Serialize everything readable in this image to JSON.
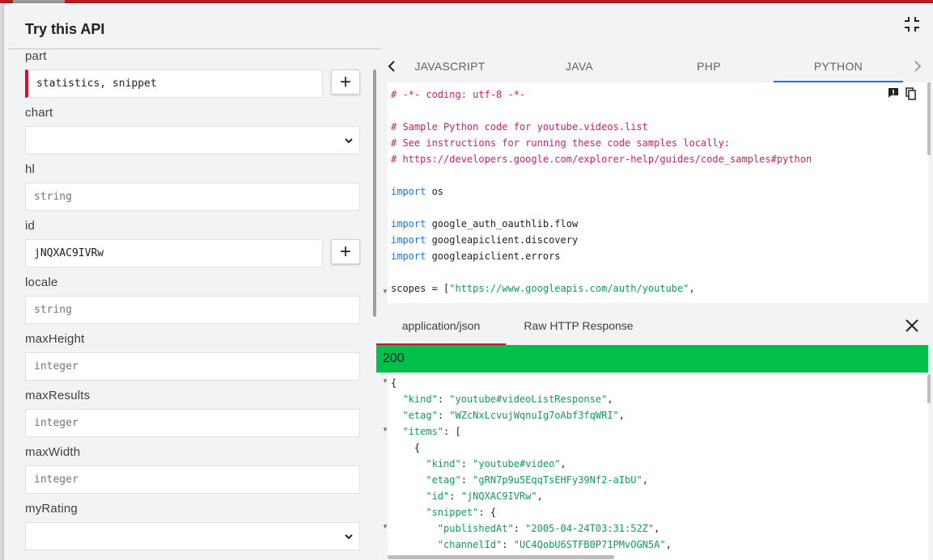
{
  "panel": {
    "title": "Try this API"
  },
  "params": [
    {
      "label": "part",
      "value": "statistics, snippet",
      "placeholder": "",
      "type": "text",
      "required": true,
      "has_add": true
    },
    {
      "label": "chart",
      "value": "",
      "placeholder": "",
      "type": "select",
      "required": false,
      "has_add": false
    },
    {
      "label": "hl",
      "value": "",
      "placeholder": "string",
      "type": "text",
      "required": false,
      "has_add": false
    },
    {
      "label": "id",
      "value": "jNQXAC9IVRw",
      "placeholder": "",
      "type": "text",
      "required": false,
      "has_add": true
    },
    {
      "label": "locale",
      "value": "",
      "placeholder": "string",
      "type": "text",
      "required": false,
      "has_add": false
    },
    {
      "label": "maxHeight",
      "value": "",
      "placeholder": "integer",
      "type": "text",
      "required": false,
      "has_add": false
    },
    {
      "label": "maxResults",
      "value": "",
      "placeholder": "integer",
      "type": "text",
      "required": false,
      "has_add": false
    },
    {
      "label": "maxWidth",
      "value": "",
      "placeholder": "integer",
      "type": "text",
      "required": false,
      "has_add": false
    },
    {
      "label": "myRating",
      "value": "",
      "placeholder": "",
      "type": "select",
      "required": false,
      "has_add": false
    }
  ],
  "add_symbol": "+",
  "lang_tabs": [
    "JAVASCRIPT",
    "JAVA",
    "PHP",
    "PYTHON"
  ],
  "active_lang": "PYTHON",
  "code_lines": [
    [
      {
        "t": "# -*- coding: utf-8 -*-",
        "c": "comment"
      }
    ],
    [],
    [
      {
        "t": "# Sample Python code for youtube.videos.list",
        "c": "comment"
      }
    ],
    [
      {
        "t": "# See instructions for running these code samples locally:",
        "c": "comment"
      }
    ],
    [
      {
        "t": "# https://developers.google.com/explorer-help/guides/code_samples#python",
        "c": "comment"
      }
    ],
    [],
    [
      {
        "t": "import",
        "c": "kw"
      },
      {
        "t": " os",
        "c": "plain"
      }
    ],
    [],
    [
      {
        "t": "import",
        "c": "kw"
      },
      {
        "t": " google_auth_oauthlib.flow",
        "c": "plain"
      }
    ],
    [
      {
        "t": "import",
        "c": "kw"
      },
      {
        "t": " googleapiclient.discovery",
        "c": "plain"
      }
    ],
    [
      {
        "t": "import",
        "c": "kw"
      },
      {
        "t": " googleapiclient.errors",
        "c": "plain"
      }
    ],
    [],
    [
      {
        "t": "scopes = [",
        "c": "plain"
      },
      {
        "t": "\"https://www.googleapis.com/auth/youtube\"",
        "c": "str"
      },
      {
        "t": ",",
        "c": "plain"
      }
    ]
  ],
  "response_tabs": [
    "application/json",
    "Raw HTTP Response"
  ],
  "active_response_tab": "application/json",
  "status_code": "200",
  "json_lines": [
    [
      {
        "t": "{",
        "c": "p"
      }
    ],
    [
      {
        "t": "  ",
        "c": "p"
      },
      {
        "t": "\"kind\"",
        "c": "key"
      },
      {
        "t": ": ",
        "c": "p"
      },
      {
        "t": "\"youtube#videoListResponse\"",
        "c": "str"
      },
      {
        "t": ",",
        "c": "p"
      }
    ],
    [
      {
        "t": "  ",
        "c": "p"
      },
      {
        "t": "\"etag\"",
        "c": "key"
      },
      {
        "t": ": ",
        "c": "p"
      },
      {
        "t": "\"WZcNxLcvujWqnuIg7oAbf3fqWRI\"",
        "c": "str"
      },
      {
        "t": ",",
        "c": "p"
      }
    ],
    [
      {
        "t": "  ",
        "c": "p"
      },
      {
        "t": "\"items\"",
        "c": "key"
      },
      {
        "t": ": [",
        "c": "p"
      }
    ],
    [
      {
        "t": "    {",
        "c": "p"
      }
    ],
    [
      {
        "t": "      ",
        "c": "p"
      },
      {
        "t": "\"kind\"",
        "c": "key"
      },
      {
        "t": ": ",
        "c": "p"
      },
      {
        "t": "\"youtube#video\"",
        "c": "str"
      },
      {
        "t": ",",
        "c": "p"
      }
    ],
    [
      {
        "t": "      ",
        "c": "p"
      },
      {
        "t": "\"etag\"",
        "c": "key"
      },
      {
        "t": ": ",
        "c": "p"
      },
      {
        "t": "\"gRN7p9u5EqqTsEHFy39Nf2-aIbU\"",
        "c": "str"
      },
      {
        "t": ",",
        "c": "p"
      }
    ],
    [
      {
        "t": "      ",
        "c": "p"
      },
      {
        "t": "\"id\"",
        "c": "key"
      },
      {
        "t": ": ",
        "c": "p"
      },
      {
        "t": "\"jNQXAC9IVRw\"",
        "c": "str"
      },
      {
        "t": ",",
        "c": "p"
      }
    ],
    [
      {
        "t": "      ",
        "c": "p"
      },
      {
        "t": "\"snippet\"",
        "c": "key"
      },
      {
        "t": ": {",
        "c": "p"
      }
    ],
    [
      {
        "t": "        ",
        "c": "p"
      },
      {
        "t": "\"publishedAt\"",
        "c": "key"
      },
      {
        "t": ": ",
        "c": "p"
      },
      {
        "t": "\"2005-04-24T03:31:52Z\"",
        "c": "str"
      },
      {
        "t": ",",
        "c": "p"
      }
    ],
    [
      {
        "t": "        ",
        "c": "p"
      },
      {
        "t": "\"channelId\"",
        "c": "key"
      },
      {
        "t": ": ",
        "c": "p"
      },
      {
        "t": "\"UC4QobU6STFB0P71PMvOGN5A\"",
        "c": "str"
      },
      {
        "t": ",",
        "c": "p"
      }
    ]
  ],
  "colors": {
    "accent_red": "#d50f2a",
    "success_green": "#00c04b",
    "active_tab_underline": "#1a73e8"
  }
}
